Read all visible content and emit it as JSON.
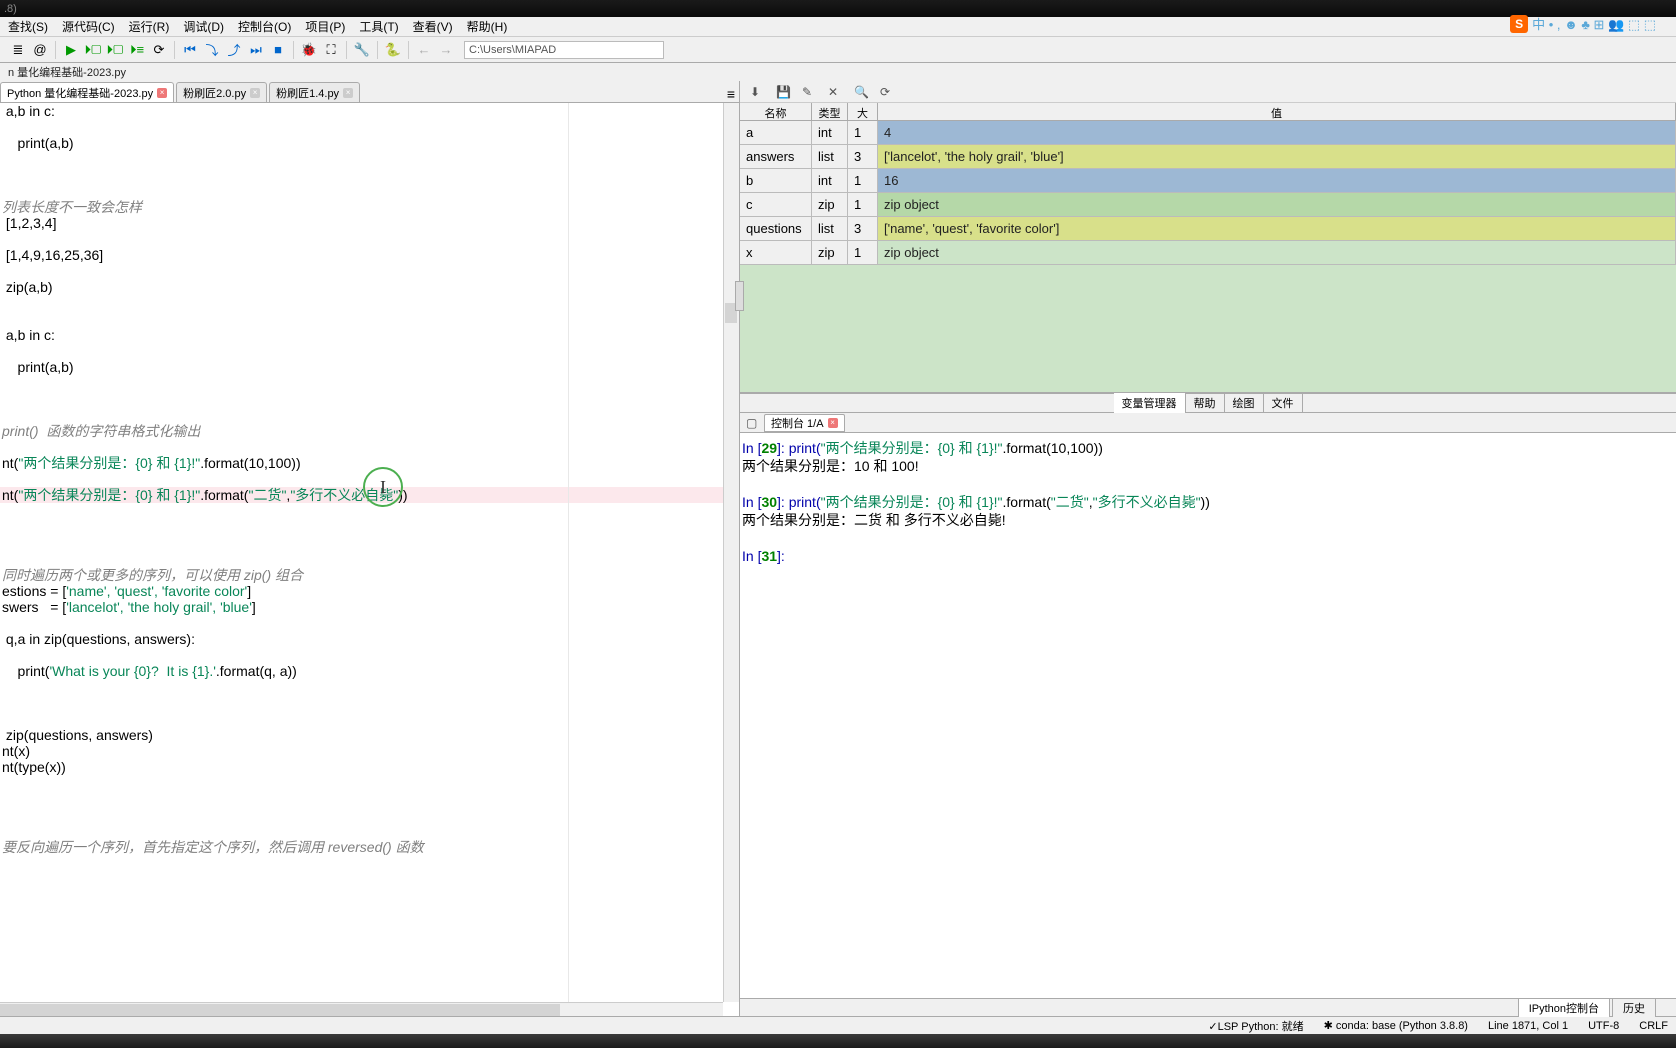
{
  "title_segments": [
    ".8)",
    "",
    "",
    ""
  ],
  "input_method": {
    "s_label": "S",
    "icons": "中 • , ☻ ♣ ⊞ 👥 ⬚ ⬚"
  },
  "menu": [
    "查找(S)",
    "源代码(C)",
    "运行(R)",
    "调试(D)",
    "控制台(O)",
    "项目(P)",
    "工具(T)",
    "查看(V)",
    "帮助(H)"
  ],
  "toolbar_path": "C:\\Users\\MIAPAD",
  "crumb": "n 量化编程基础-2023.py",
  "editor_tabs": [
    {
      "label": "Python 量化编程基础-2023.py",
      "active": true,
      "close": "red"
    },
    {
      "label": "粉刷匠2.0.py",
      "active": false,
      "close": "gray"
    },
    {
      "label": "粉刷匠1.4.py",
      "active": false,
      "close": "gray"
    }
  ],
  "code": {
    "l1": " a,b in c:",
    "l2": "    print(a,b)",
    "l3": "列表长度不一致会怎样",
    "l4": " [1,2,3,4]",
    "l5": " [1,4,9,16,25,36]",
    "l6": " zip(a,b)",
    "l7": " a,b in c:",
    "l8": "    print(a,b)",
    "l9": "print()  函数的字符串格式化输出",
    "l10a": "nt(",
    "l10s": "\"两个结果分别是：{0} 和 {1}!\"",
    "l10b": ".format(10,100))",
    "l11a": "nt(",
    "l11s": "\"两个结果分别是：{0} 和 {1}!\"",
    "l11b": ".format(",
    "l11s2": "\"二货\"",
    "l11c": ",",
    "l11s3": "\"多行不义必自毙\"",
    "l11d": "))",
    "l12": "同时遍历两个或更多的序列，可以使用 zip() 组合",
    "l13a": "estions = [",
    "l13s": "'name', 'quest', 'favorite color'",
    "l13b": "]",
    "l14a": "swers   = [",
    "l14s": "'lancelot', 'the holy grail', 'blue'",
    "l14b": "]",
    "l15": " q,a in zip(questions, answers):",
    "l16a": "    print(",
    "l16s": "'What is your {0}?  It is {1}.'",
    "l16b": ".format(q, a))",
    "l17": " zip(questions, answers)",
    "l18": "nt(x)",
    "l19": "nt(type(x))",
    "l20": "要反向遍历一个序列，首先指定这个序列，然后调用 reversed() 函数"
  },
  "var_explorer": {
    "headers": {
      "name": "名称",
      "type": "类型",
      "size": "大小",
      "value": "值"
    },
    "rows": [
      {
        "name": "a",
        "type": "int",
        "size": "1",
        "value": "4",
        "bg": "bg-blue"
      },
      {
        "name": "answers",
        "type": "list",
        "size": "3",
        "value": "['lancelot', 'the holy grail', 'blue']",
        "bg": "bg-yellow"
      },
      {
        "name": "b",
        "type": "int",
        "size": "1",
        "value": "16",
        "bg": "bg-blue"
      },
      {
        "name": "c",
        "type": "zip",
        "size": "1",
        "value": "zip object",
        "bg": "bg-green"
      },
      {
        "name": "questions",
        "type": "list",
        "size": "3",
        "value": "['name', 'quest', 'favorite color']",
        "bg": "bg-yellow"
      },
      {
        "name": "x",
        "type": "zip",
        "size": "1",
        "value": "zip object",
        "bg": "bg-lightgreen"
      }
    ]
  },
  "pane_tabs": [
    "变量管理器",
    "帮助",
    "绘图",
    "文件"
  ],
  "console_tab": "控制台 1/A",
  "console": {
    "l1a": "In [",
    "l1n": "29",
    "l1b": "]: print(",
    "l1s": "\"两个结果分别是：{0} 和 {1}!\"",
    "l1c": ".format(",
    "l1d": "10",
    "l1e": ",",
    "l1f": "100",
    "l1g": "))",
    "l2": "两个结果分别是：10 和 100!",
    "l3a": "In [",
    "l3n": "30",
    "l3b": "]: print(",
    "l3s": "\"两个结果分别是：{0} 和 {1}!\"",
    "l3c": ".format(",
    "l3s2": "\"二货\"",
    "l3d": ",",
    "l3s3": "\"多行不义必自毙\"",
    "l3e": "))",
    "l4": "两个结果分别是：二货 和 多行不义必自毙!",
    "l5a": "In [",
    "l5n": "31",
    "l5b": "]: "
  },
  "bottom_tabs": [
    "IPython控制台",
    "历史"
  ],
  "status": {
    "lsp": "✓LSP Python: 就绪",
    "conda": "✱ conda: base (Python 3.8.8)",
    "line": "Line 1871, Col 1",
    "enc": "UTF-8",
    "eol": "CRLF"
  }
}
